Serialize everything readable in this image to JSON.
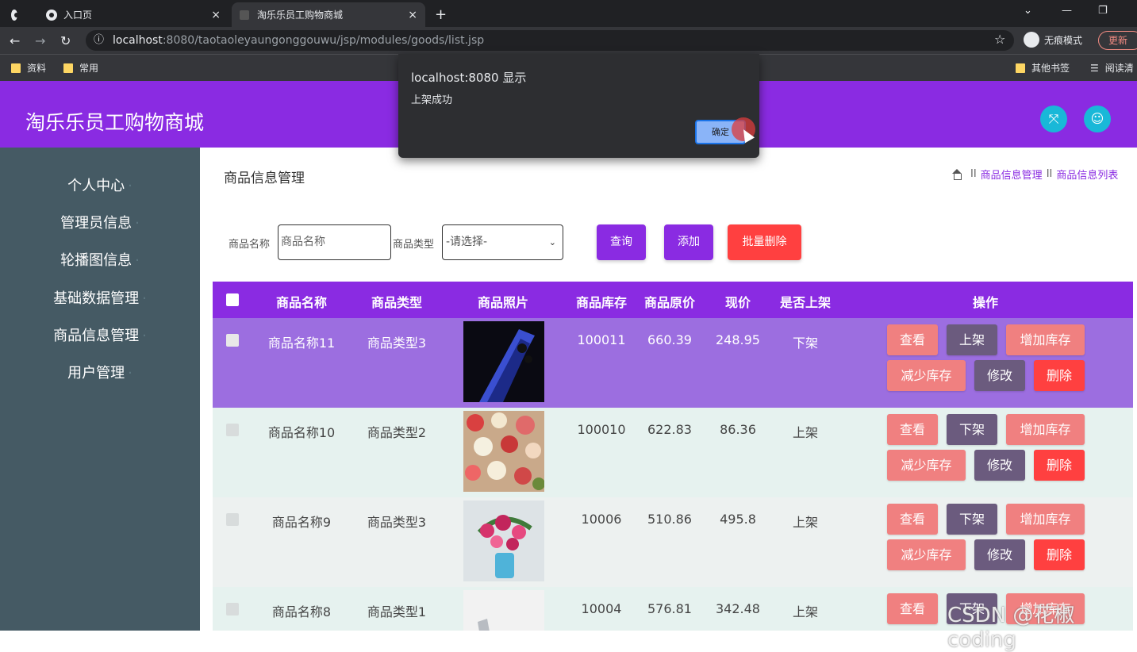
{
  "browser": {
    "tabs": [
      {
        "label": ""
      },
      {
        "label": "入口页"
      },
      {
        "label": "淘乐乐员工购物商城"
      }
    ],
    "new_tab": "+",
    "url_host": "localhost",
    "url_rest": ":8080/taotaoleyaungonggouwu/jsp/modules/goods/list.jsp",
    "incognito_label": "无痕模式",
    "new_button": "更新",
    "bookmarks": [
      "资料",
      "常用"
    ],
    "bookmarks_right": [
      "其他书签",
      "阅读清"
    ]
  },
  "dialog": {
    "title": "localhost:8080 显示",
    "message": "上架成功",
    "ok_label": "确定"
  },
  "header": {
    "brand": "淘乐乐员工购物商城",
    "icons": [
      "fullscreen-icon",
      "user-icon"
    ]
  },
  "sidebar": {
    "items": [
      {
        "label": "个人中心"
      },
      {
        "label": "管理员信息"
      },
      {
        "label": "轮播图信息"
      },
      {
        "label": "基础数据管理"
      },
      {
        "label": "商品信息管理"
      },
      {
        "label": "用户管理"
      }
    ]
  },
  "main": {
    "title": "商品信息管理",
    "breadcrumb": [
      "商品信息管理",
      "商品信息列表"
    ],
    "breadcrumb_sep": "II",
    "filters": {
      "name_label": "商品名称",
      "name_placeholder": "商品名称",
      "type_label": "商品类型",
      "type_selected": "-请选择-",
      "search_label": "查询",
      "add_label": "添加",
      "batch_delete_label": "批量删除"
    },
    "table": {
      "headers": [
        "商品名称",
        "商品类型",
        "商品照片",
        "商品库存",
        "商品原价",
        "现价",
        "是否上架",
        "操作"
      ],
      "rows": [
        {
          "name": "商品名称11",
          "type": "商品类型3",
          "stock": "100011",
          "orig": "660.39",
          "price": "248.95",
          "status": "下架",
          "toggle": "上架"
        },
        {
          "name": "商品名称10",
          "type": "商品类型2",
          "stock": "100010",
          "orig": "622.83",
          "price": "86.36",
          "status": "上架",
          "toggle": "下架"
        },
        {
          "name": "商品名称9",
          "type": "商品类型3",
          "stock": "10006",
          "orig": "510.86",
          "price": "495.8",
          "status": "上架",
          "toggle": "下架"
        },
        {
          "name": "商品名称8",
          "type": "商品类型1",
          "stock": "10004",
          "orig": "576.81",
          "price": "342.48",
          "status": "上架",
          "toggle": "下架"
        }
      ],
      "actions": {
        "view": "查看",
        "add_stock": "增加库存",
        "reduce_stock": "减少库存",
        "edit": "修改",
        "delete": "删除"
      }
    }
  },
  "watermark": "CSDN @花椒coding",
  "colors": {
    "primary": "#8a2be2",
    "sidebar": "#455a64",
    "row_selected": "#9c6ee0",
    "row_alt": "#e6f2ef",
    "btn_pink": "#f08080",
    "btn_slate": "#6b5b7e",
    "btn_red": "#ff4040",
    "header_icons": "#19b8d8"
  }
}
